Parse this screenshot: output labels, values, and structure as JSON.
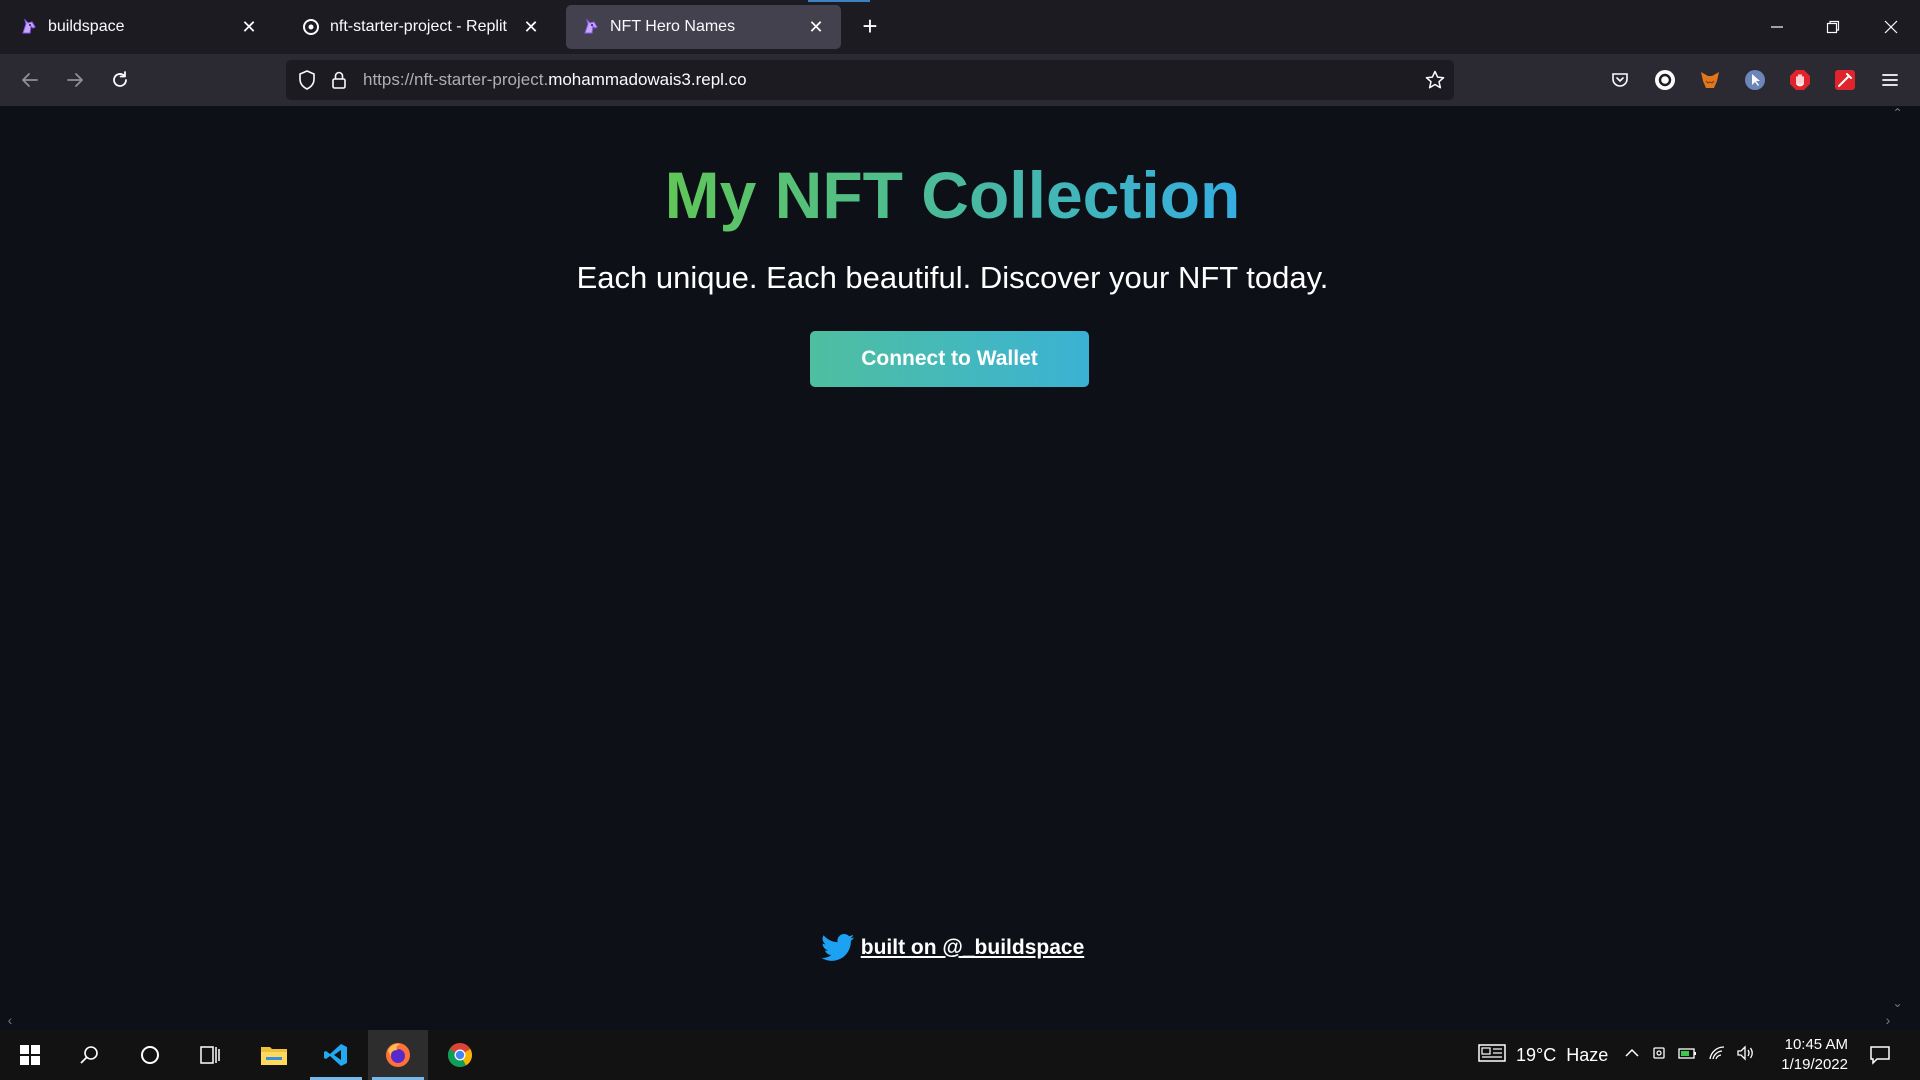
{
  "browser": {
    "tabs": [
      {
        "title": "buildspace",
        "active": false,
        "icon": "unicorn-icon"
      },
      {
        "title": "nft-starter-project - Replit",
        "active": false,
        "icon": "replit-icon"
      },
      {
        "title": "NFT Hero Names",
        "active": true,
        "icon": "unicorn-icon"
      }
    ],
    "url_prefix": "https://nft-starter-project.",
    "url_domain": "mohammadowais3.repl.co"
  },
  "page": {
    "header": "My NFT Collection",
    "subtext": "Each unique. Each beautiful. Discover your NFT today.",
    "connect_button": "Connect to Wallet",
    "footer_link": "built on @_buildspace"
  },
  "taskbar": {
    "weather_temp": "19°C",
    "weather_desc": "Haze",
    "time": "10:45 AM",
    "date": "1/19/2022"
  },
  "colors": {
    "page_bg": "#0d1117",
    "gradient_start": "#60c657",
    "gradient_end": "#35aee2",
    "twitter_blue": "#1da1f2"
  }
}
